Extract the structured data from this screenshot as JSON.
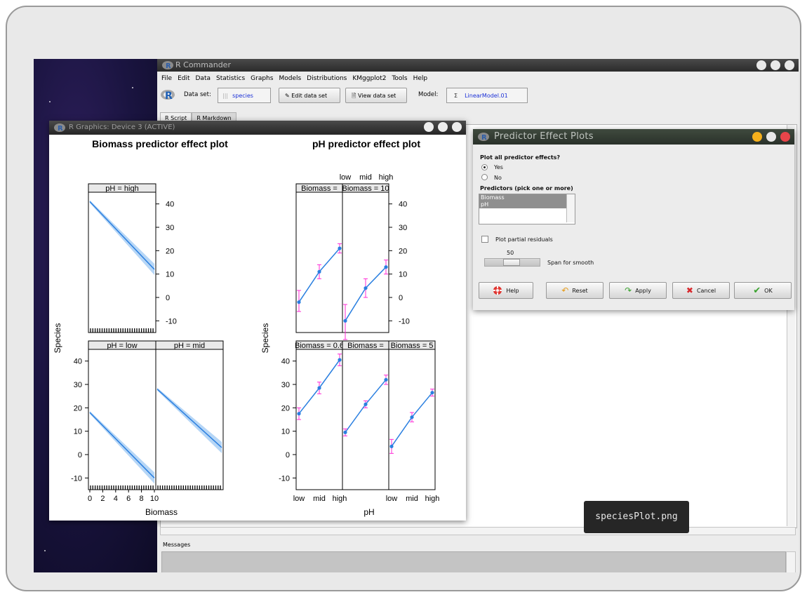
{
  "rcommander": {
    "window_title": "R Commander",
    "menu": [
      "File",
      "Edit",
      "Data",
      "Statistics",
      "Graphs",
      "Models",
      "Distributions",
      "KMggplot2",
      "Tools",
      "Help"
    ],
    "dataset_label": "Data set:",
    "dataset_value": "species",
    "edit_dataset": "Edit data set",
    "view_dataset": "View data set",
    "model_label": "Model:",
    "model_sigma": "Σ",
    "model_value": "LinearModel.01",
    "tabs": [
      "R Script",
      "R Markdown"
    ],
    "messages_label": "Messages"
  },
  "graphics": {
    "window_title": "R Graphics: Device 3 (ACTIVE)",
    "left_title": "Biomass predictor effect plot",
    "right_title": "pH predictor effect plot",
    "ylabel": "Species",
    "left_xlabel": "Biomass",
    "right_xlabel": "pH",
    "left_panels": [
      "pH = high",
      "pH = low",
      "pH = mid"
    ],
    "right_panels_top": [
      "Biomass =",
      "Biomass = 10"
    ],
    "right_panels_bottom": [
      "Biomass = 0.6",
      "Biomass =",
      "Biomass = 5"
    ],
    "left_yticks_right": [
      "40",
      "30",
      "20",
      "10",
      "0",
      "-10"
    ],
    "left_yticks_left": [
      "40",
      "30",
      "20",
      "10",
      "0",
      "-10"
    ],
    "left_xticks": [
      "0",
      "2",
      "4",
      "6",
      "8",
      "10"
    ],
    "right_xticks_top": [
      "low",
      "mid",
      "high"
    ],
    "right_xticks_bottom": [
      "low",
      "mid",
      "high"
    ],
    "right_xticks_bottom2": [
      "low",
      "mid",
      "high"
    ]
  },
  "chart_data": [
    {
      "type": "line",
      "title": "Biomass predictor effect plot",
      "xlabel": "Biomass",
      "ylabel": "Species",
      "xlim": [
        0,
        10
      ],
      "ylim": [
        -15,
        45
      ],
      "panels": [
        {
          "name": "pH = high",
          "x": [
            0,
            10
          ],
          "y": [
            41,
            12
          ]
        },
        {
          "name": "pH = low",
          "x": [
            0,
            10
          ],
          "y": [
            18,
            -10
          ]
        },
        {
          "name": "pH = mid",
          "x": [
            0,
            10
          ],
          "y": [
            28,
            3
          ]
        }
      ]
    },
    {
      "type": "line",
      "title": "pH predictor effect plot",
      "xlabel": "pH",
      "ylabel": "Species",
      "categories": [
        "low",
        "mid",
        "high"
      ],
      "ylim": [
        -15,
        45
      ],
      "series": [
        {
          "name": "Biomass = 10",
          "values": [
            -10,
            4,
            13
          ],
          "lower": [
            -18,
            0,
            10
          ],
          "upper": [
            -3,
            8,
            16
          ]
        },
        {
          "name": "Biomass =",
          "values": [
            -2,
            11,
            21
          ],
          "lower": [
            -6,
            8,
            19
          ],
          "upper": [
            3,
            14,
            23
          ]
        },
        {
          "name": "Biomass = 0.6",
          "values": [
            17.5,
            28.5,
            40.5
          ],
          "lower": [
            15,
            26,
            38
          ],
          "upper": [
            20,
            31,
            43
          ]
        },
        {
          "name": "Biomass =",
          "values": [
            9.5,
            21.5,
            32
          ],
          "lower": [
            8,
            20,
            30
          ],
          "upper": [
            11,
            23,
            34
          ]
        },
        {
          "name": "Biomass = 5",
          "values": [
            3.5,
            16,
            26.5
          ],
          "lower": [
            0.5,
            14,
            25
          ],
          "upper": [
            6.5,
            18,
            28
          ]
        }
      ]
    }
  ],
  "dialog": {
    "title": "Predictor Effect Plots",
    "plot_all_label": "Plot all predictor effects?",
    "yes": "Yes",
    "no": "No",
    "predictors_label": "Predictors (pick one or more)",
    "predictors": [
      "Biomass",
      "pH"
    ],
    "partial_residuals": "Plot partial residuals",
    "span_value": "50",
    "span_label": "Span for smooth",
    "help": "Help",
    "reset": "Reset",
    "apply": "Apply",
    "cancel": "Cancel",
    "ok": "OK"
  },
  "caption": "speciesPlot.png",
  "colors": {
    "line": "#2a7fe0",
    "band": "#a9cff5",
    "errorbar": "#ff2bd6"
  }
}
